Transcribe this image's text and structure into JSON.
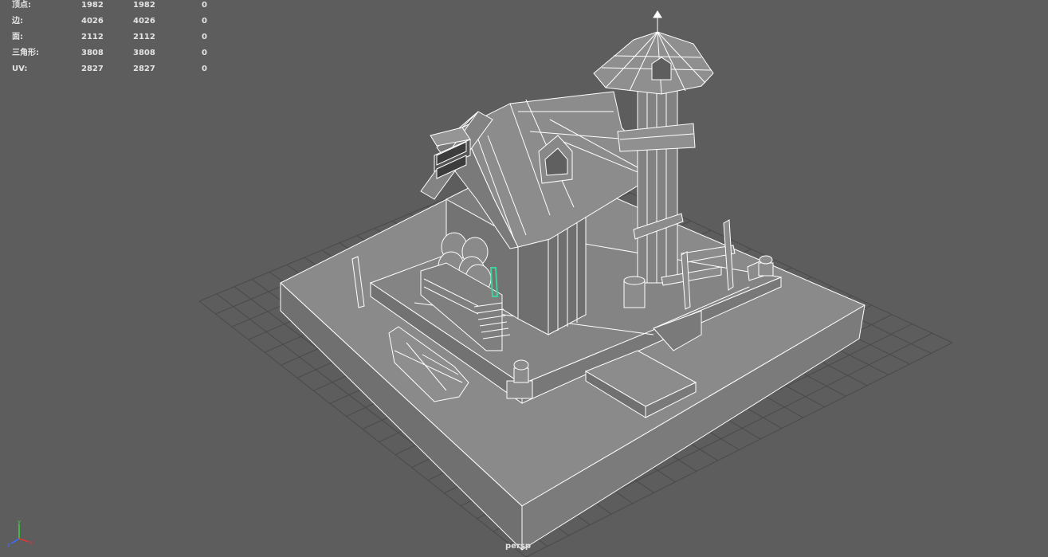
{
  "app": {
    "name": "Maya viewport"
  },
  "hud": {
    "rows": [
      {
        "label": "顶点:",
        "a": "1982",
        "b": "1982",
        "c": "0"
      },
      {
        "label": "边:",
        "a": "4026",
        "b": "4026",
        "c": "0"
      },
      {
        "label": "面:",
        "a": "2112",
        "b": "2112",
        "c": "0"
      },
      {
        "label": "三角形:",
        "a": "3808",
        "b": "3808",
        "c": "0"
      },
      {
        "label": "UV:",
        "a": "2827",
        "b": "2827",
        "c": "0"
      }
    ]
  },
  "camera": {
    "name": "persp"
  },
  "axis": {
    "x": "x",
    "y": "y",
    "z": "z"
  },
  "colors": {
    "background": "#5d5d5d",
    "grid": "#4a4a4a",
    "mesh_fill": "#7f7f7f",
    "mesh_fill_dark": "#696969",
    "wire": "#ffffff",
    "selected": "#3fd39b",
    "axis_x": "#e33434",
    "axis_y": "#3cd43c",
    "axis_z": "#3c6cff"
  },
  "icons": {
    "axis_gizmo": "xyz-axis-icon"
  }
}
